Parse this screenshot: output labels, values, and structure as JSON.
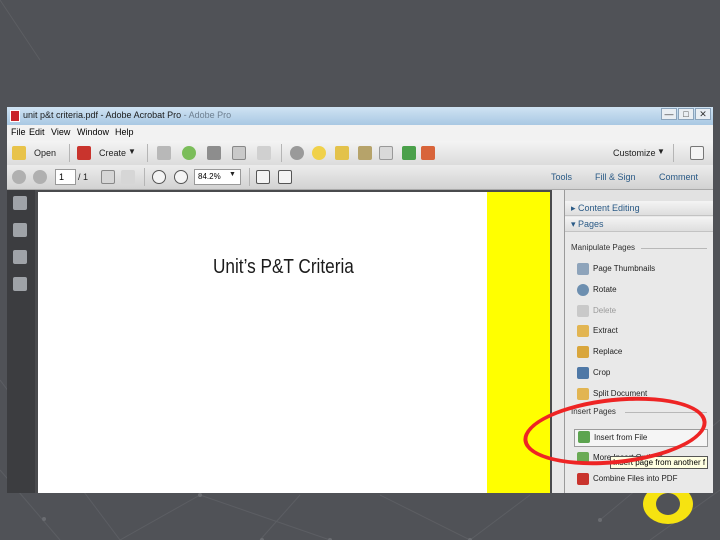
{
  "window": {
    "title": "unit p&t criteria.pdf - Adobe Acrobat Pro",
    "title_suffix": " - Adobe Pro",
    "buttons": [
      "—",
      "□",
      "✕"
    ]
  },
  "menu": [
    "File",
    "Edit",
    "View",
    "Window",
    "Help"
  ],
  "toolbar": {
    "open_label": "Open",
    "create_label": "Create",
    "customize_label": "Customize",
    "page_current": "1",
    "page_total": "/ 1",
    "zoom_value": "84.2%",
    "tabs": [
      "Tools",
      "Fill & Sign",
      "Comment"
    ]
  },
  "document": {
    "title": "Unit’s P&T Criteria",
    "accent_color": "#ffff00"
  },
  "panel": {
    "content_editing": "Content Editing",
    "pages": "Pages",
    "manipulate_title": "Manipulate Pages",
    "manipulate_items": [
      "Page Thumbnails",
      "Rotate",
      "Delete",
      "Extract",
      "Replace",
      "Crop",
      "Split Document"
    ],
    "insert_title": "Insert Pages",
    "insert_items": [
      "Insert from File",
      "More Insert Options",
      "Combine Files into PDF"
    ]
  },
  "tooltip": "Insert page from another f",
  "annotation_color": "#ee2424"
}
